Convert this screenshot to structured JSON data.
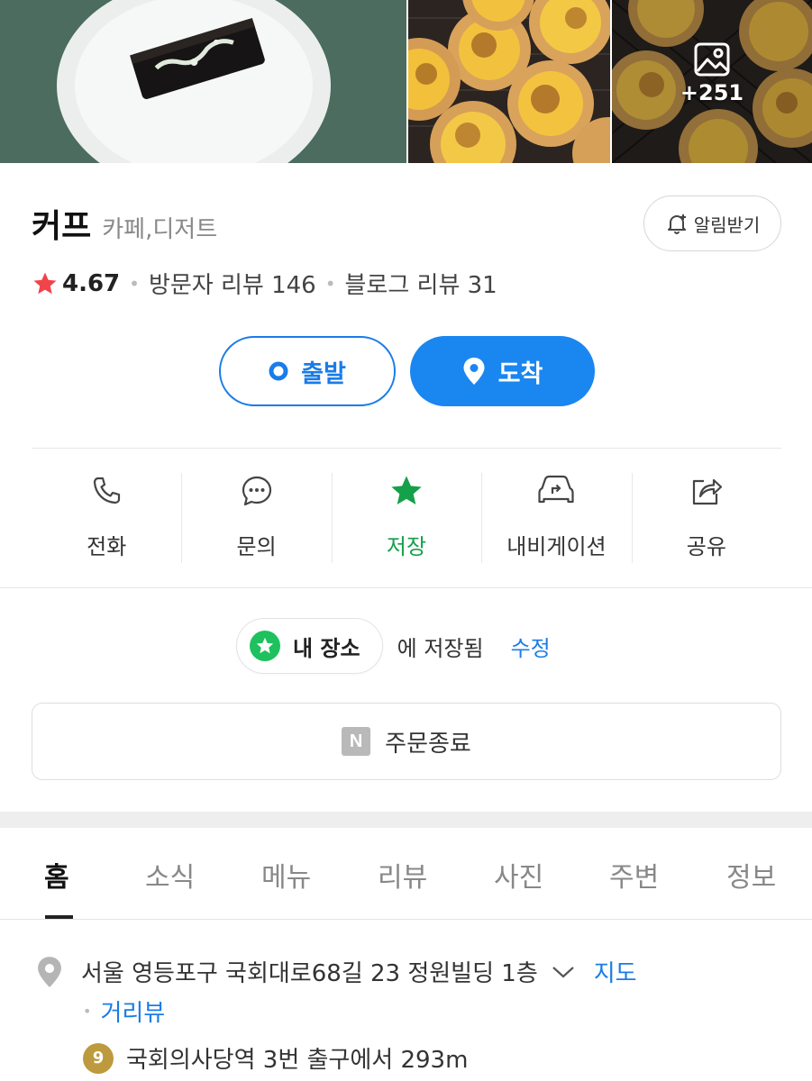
{
  "photos": {
    "more_count": "+251"
  },
  "place": {
    "name": "커프",
    "category": "카페,디저트",
    "alert_label": "알림받기"
  },
  "rating": {
    "score": "4.67",
    "visitor_reviews": "방문자 리뷰 146",
    "blog_reviews": "블로그 리뷰 31"
  },
  "route": {
    "depart_label": "출발",
    "arrive_label": "도착"
  },
  "actions": [
    {
      "label": "전화",
      "icon": "phone-icon"
    },
    {
      "label": "문의",
      "icon": "chat-icon"
    },
    {
      "label": "저장",
      "icon": "star-icon"
    },
    {
      "label": "내비게이션",
      "icon": "navigation-icon"
    },
    {
      "label": "공유",
      "icon": "share-icon"
    }
  ],
  "saved": {
    "list_name": "내 장소",
    "saved_text": "에 저장됨",
    "edit_label": "수정"
  },
  "order": {
    "badge": "N",
    "status": "주문종료"
  },
  "tabs": [
    {
      "label": "홈",
      "active": true
    },
    {
      "label": "소식"
    },
    {
      "label": "메뉴"
    },
    {
      "label": "리뷰"
    },
    {
      "label": "사진"
    },
    {
      "label": "주변"
    },
    {
      "label": "정보"
    }
  ],
  "info": {
    "address": "서울 영등포구 국회대로68길 23 정원빌딩 1층",
    "map_link": "지도",
    "street_view": "거리뷰",
    "subway_line": "9",
    "subway_directions": "국회의사당역 3번 출구에서 293m"
  },
  "colors": {
    "accent_blue": "#1a86f0",
    "saved_green": "#15a04a",
    "rating_star": "#f0444a",
    "line9_gold": "#bd9a3e"
  }
}
